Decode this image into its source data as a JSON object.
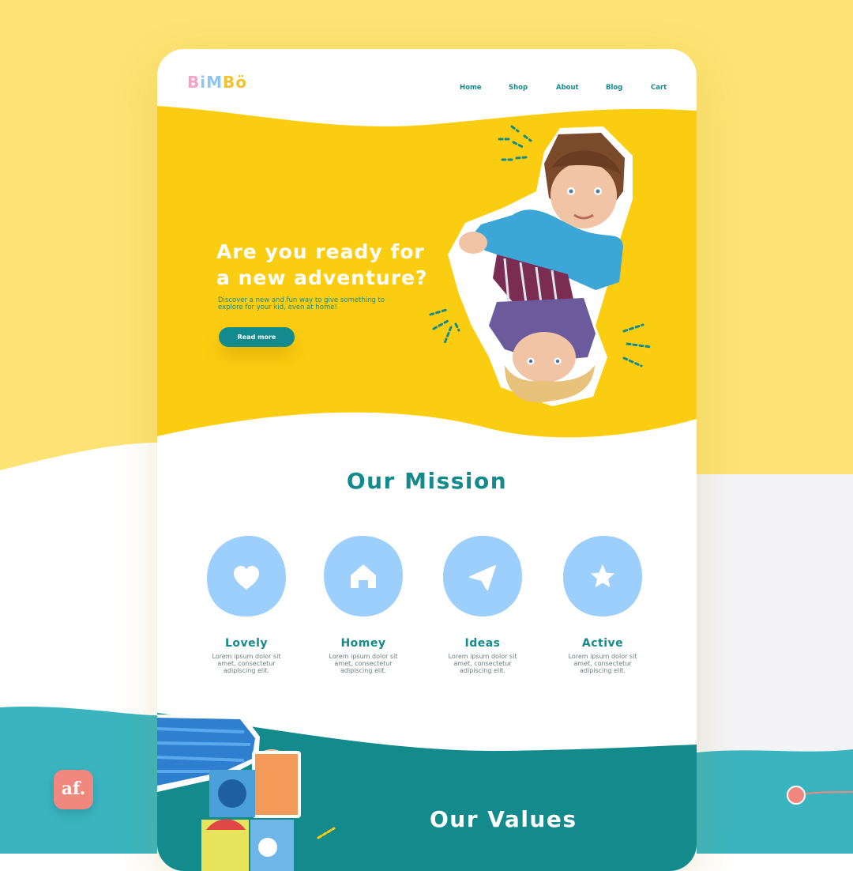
{
  "brand": {
    "logo_letters": [
      "B",
      "i",
      "M",
      "B",
      "ö"
    ],
    "logo_colors": [
      "#f5a3c7",
      "#8ec5f5",
      "#8ec5f5",
      "#f2c230",
      "#f2c230"
    ]
  },
  "nav": {
    "items": [
      "Home",
      "Shop",
      "About",
      "Blog",
      "Cart"
    ]
  },
  "hero": {
    "title_line1": "Are you ready for",
    "title_line2": "a new adventure?",
    "subtitle_line1": "Discover a new and fun way to give something to",
    "subtitle_line2": "explore for your kid, even at home!",
    "button_label": "Read more"
  },
  "mission": {
    "title": "Our Mission",
    "features": [
      {
        "label": "Lovely",
        "desc1": "Lorem ipsum dolor sit",
        "desc2": "amet, consectetur",
        "desc3": "adipiscing elit.",
        "icon": "heart-icon"
      },
      {
        "label": "Homey",
        "desc1": "Lorem ipsum dolor sit",
        "desc2": "amet, consectetur",
        "desc3": "adipiscing elit.",
        "icon": "home-icon"
      },
      {
        "label": "Ideas",
        "desc1": "Lorem ipsum dolor sit",
        "desc2": "amet, consectetur",
        "desc3": "adipiscing elit.",
        "icon": "paper-plane-icon"
      },
      {
        "label": "Active",
        "desc1": "Lorem ipsum dolor sit",
        "desc2": "amet, consectetur",
        "desc3": "adipiscing elit.",
        "icon": "star-icon"
      }
    ]
  },
  "values": {
    "title": "Our Values"
  },
  "badge": {
    "label": "af."
  },
  "colors": {
    "yellow": "#fbcd11",
    "teal": "#138a8c",
    "light_blue": "#9ccffb",
    "background_yellow": "#fde373",
    "background_teal": "#3ab5c0",
    "coral": "#f08880"
  }
}
